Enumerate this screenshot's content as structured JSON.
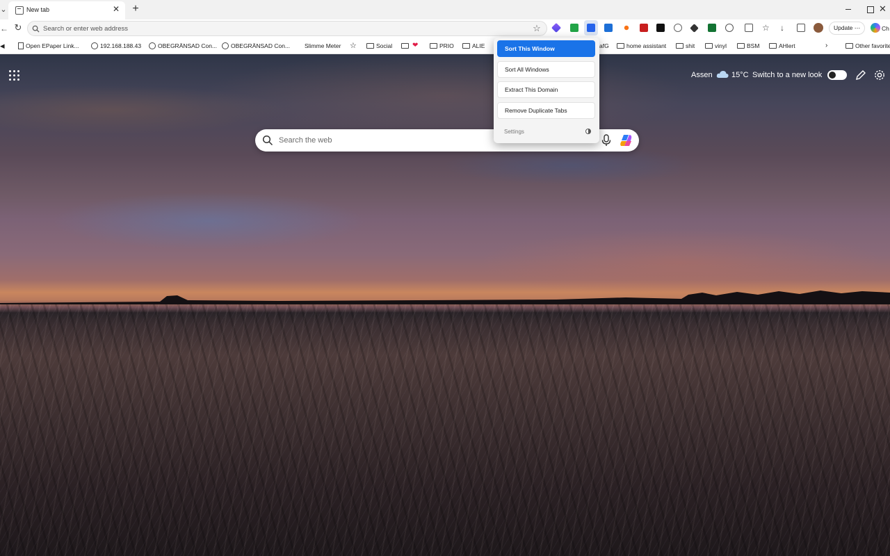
{
  "browser": {
    "tab": {
      "title": "New tab"
    },
    "address": {
      "placeholder": "Search or enter web address"
    },
    "update_label": "Update ⋯",
    "copilot_label": "Ch"
  },
  "bookmarks": [
    {
      "label": "Open EPaper Link...",
      "icon": "document-icon"
    },
    {
      "label": "192.168.188.43",
      "icon": "globe-icon"
    },
    {
      "label": "OBEGRÄNSAD Con...",
      "icon": "globe-icon"
    },
    {
      "label": "OBEGRÄNSAD Con...",
      "icon": "globe-icon"
    },
    {
      "label": "Slimme Meter",
      "icon": ""
    },
    {
      "label": "Social",
      "icon": "folder-icon"
    },
    {
      "label": "PRIO",
      "icon": "folder-icon"
    },
    {
      "label": "ALIE",
      "icon": "folder-icon"
    },
    {
      "label": "afG",
      "icon": ""
    },
    {
      "label": "home assistant",
      "icon": "folder-icon"
    },
    {
      "label": "shit",
      "icon": "folder-icon"
    },
    {
      "label": "vinyl",
      "icon": "folder-icon"
    },
    {
      "label": "BSM",
      "icon": "folder-icon"
    },
    {
      "label": "AHlert",
      "icon": "folder-icon"
    },
    {
      "label": "Other favorite",
      "icon": "folder-icon"
    }
  ],
  "popup": {
    "buttons": [
      "Sort This Window",
      "Sort All Windows",
      "Extract This Domain",
      "Remove Duplicate Tabs"
    ],
    "settings_label": "Settings",
    "primary_color": "#1a73e8"
  },
  "newtab": {
    "weather": {
      "location": "Assen",
      "temperature": "15°C",
      "icon": "cloud-icon"
    },
    "newlook_label": "Switch to a new look",
    "newlook_enabled": false,
    "search_placeholder": "Search the web"
  }
}
